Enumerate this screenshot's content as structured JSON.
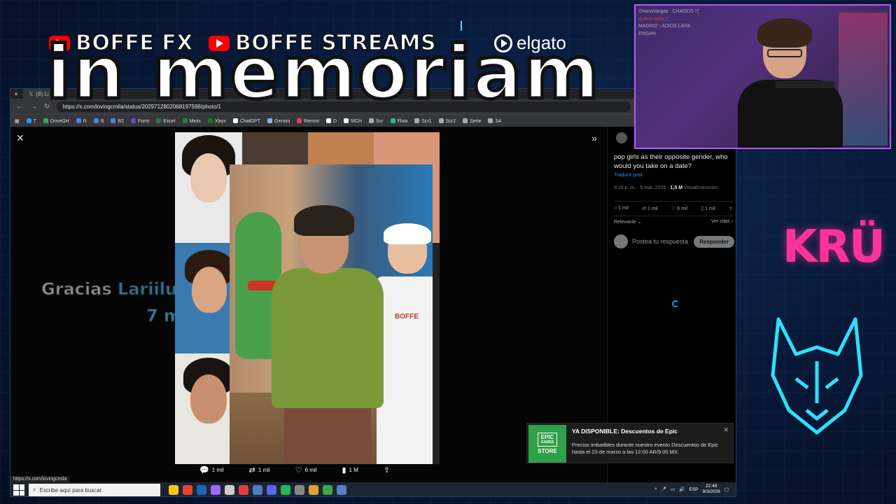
{
  "overlay": {
    "channel_1": "BOFFE FX",
    "channel_2": "BOFFE STREAMS",
    "sponsor": "elgato",
    "headline": "in memoriam",
    "right_logo": "KRÜ"
  },
  "browser": {
    "tab_title": "(8) Li",
    "url": "https://x.com/lovingcmila/status/2029712802068197598/photo/1",
    "bookmarks": [
      {
        "label": "T",
        "color": "#1d9bf0"
      },
      {
        "label": "DriveGH",
        "color": "#34a853"
      },
      {
        "label": "R",
        "color": "#4285f4"
      },
      {
        "label": "B",
        "color": "#4285f4"
      },
      {
        "label": "B2",
        "color": "#4285f4"
      },
      {
        "label": "Form",
        "color": "#7248b9"
      },
      {
        "label": "Excel",
        "color": "#1e7e45"
      },
      {
        "label": "Minis",
        "color": "#1e7e45"
      },
      {
        "label": "Xbox",
        "color": "#107c10"
      },
      {
        "label": "ChatGPT",
        "color": "#ffffff"
      },
      {
        "label": "Gemini",
        "color": "#8ab4f8"
      },
      {
        "label": "Remini",
        "color": "#e04060"
      },
      {
        "label": "D",
        "color": "#ffffff"
      },
      {
        "label": "MCH",
        "color": "#ffffff"
      },
      {
        "label": "Scr",
        "color": "#aaaaaa"
      },
      {
        "label": "Flow",
        "color": "#19c37d"
      },
      {
        "label": "Scr1",
        "color": "#aaaaaa"
      },
      {
        "label": "Scr2",
        "color": "#aaaaaa"
      },
      {
        "label": "Serie",
        "color": "#aaaaaa"
      },
      {
        "label": "S4",
        "color": "#aaaaaa"
      }
    ],
    "status_link": "https://x.com/lovingcmila"
  },
  "viewer": {
    "stream_alert_line1_prefix": "Gracias",
    "stream_alert_name": "Lariiluu",
    "stream_alert_line2": "7 meses",
    "apron_text": "BOFFE",
    "actions": {
      "reply": "1 mil",
      "repost": "1 mil",
      "like": "6 mil",
      "views": "1 M"
    }
  },
  "post": {
    "text": "pop girls as their opposite gender, who would you take on a date?",
    "translate": "Traducir post",
    "time": "9:16 p. m. · 5 mar. 2026 ·",
    "views_count": "1,5 M",
    "views_label": "Visualizaciones",
    "stats": {
      "reply": "1 mil",
      "repost": "1 mil",
      "like": "6 mil",
      "bookmark": "1 mil"
    },
    "sort_label": "Relevante",
    "quotes_label": "Ver citas",
    "reply_placeholder": "Postea tu respuesta",
    "reply_button": "Responder"
  },
  "toast": {
    "title": "YA DISPONIBLE: Descuentos de Epic",
    "body": "Precios imbatibles durante nuestro evento Descuentos de Epic hasta el 23 de marzo a las 12:00 AR/9:00 MX.",
    "logo_text_1": "EPIC",
    "logo_text_2": "GAMES",
    "logo_text_3": "STORE"
  },
  "taskbar": {
    "search_placeholder": "Escribe aquí para buscar.",
    "language": "ESP",
    "time": "22:48",
    "date": "9/3/2026",
    "app_colors": [
      "#f0c419",
      "#e94235",
      "#1f5fbf",
      "#9a6aff",
      "#cccccc",
      "#e23b3b",
      "#4c7cc4",
      "#5865f2",
      "#1db954",
      "#888888",
      "#e0a030",
      "#3aa64a",
      "#5a7acc"
    ]
  },
  "webcam": {
    "chat_lines": [
      {
        "text": "OrianaVargas : CHAOOS !!!",
        "highlight": false
      },
      {
        "text": "quiero verlo 2",
        "highlight": true
      },
      {
        "text": "MADRID : ADIOS LARII",
        "highlight": false
      },
      {
        "text": "ENGAN",
        "highlight": false
      }
    ]
  }
}
